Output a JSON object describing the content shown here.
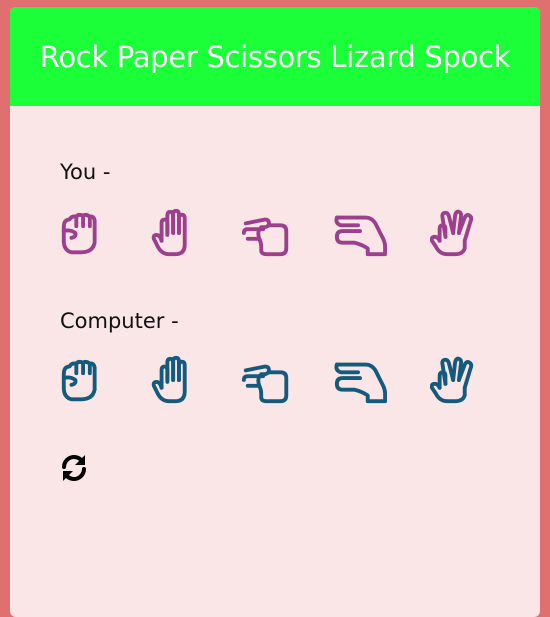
{
  "header": {
    "title": "Rock Paper Scissors Lizard Spock"
  },
  "player": {
    "label": "You -",
    "color": "#9c3f8c",
    "choices": [
      {
        "name": "rock",
        "icon": "hand-rock-icon"
      },
      {
        "name": "paper",
        "icon": "hand-paper-icon"
      },
      {
        "name": "scissors",
        "icon": "hand-scissors-icon"
      },
      {
        "name": "lizard",
        "icon": "hand-lizard-icon"
      },
      {
        "name": "spock",
        "icon": "hand-spock-icon"
      }
    ]
  },
  "computer": {
    "label": "Computer -",
    "color": "#145a7c",
    "choices": [
      {
        "name": "rock",
        "icon": "hand-rock-icon"
      },
      {
        "name": "paper",
        "icon": "hand-paper-icon"
      },
      {
        "name": "scissors",
        "icon": "hand-scissors-icon"
      },
      {
        "name": "lizard",
        "icon": "hand-lizard-icon"
      },
      {
        "name": "spock",
        "icon": "hand-spock-icon"
      }
    ]
  },
  "controls": {
    "reset_icon": "refresh-icon"
  },
  "colors": {
    "background": "#e07070",
    "card": "#fae6e6",
    "header": "#1aff38"
  }
}
